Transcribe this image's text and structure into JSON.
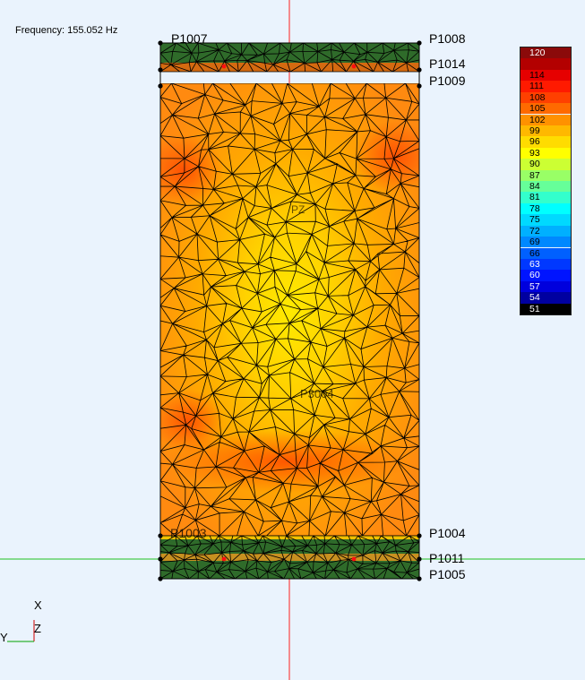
{
  "frequency_label": "Frequency: 155.052 Hz",
  "points": {
    "p1007": "P1007",
    "p1008": "P1008",
    "p1014": "P1014",
    "p1009": "P1009",
    "p1003": "P1003",
    "p1004": "P1004",
    "p1011": "P1011",
    "p1005": "P1005",
    "p3004": "P3004",
    "pz": "PZ"
  },
  "axes": {
    "x": "X",
    "y": "Y",
    "z": "Z"
  },
  "legend": {
    "entries": [
      {
        "label": "120",
        "color": "#8b0a0a"
      },
      {
        "label": "",
        "color": "#b30000"
      },
      {
        "label": "114",
        "color": "#e60000"
      },
      {
        "label": "111",
        "color": "#ff1a00"
      },
      {
        "label": "108",
        "color": "#ff4000"
      },
      {
        "label": "105",
        "color": "#ff6a00"
      },
      {
        "label": "102",
        "color": "#ff9100"
      },
      {
        "label": "99",
        "color": "#ffb800"
      },
      {
        "label": "96",
        "color": "#ffdc00"
      },
      {
        "label": "93",
        "color": "#ffff00"
      },
      {
        "label": "90",
        "color": "#ccff33"
      },
      {
        "label": "87",
        "color": "#99ff66"
      },
      {
        "label": "84",
        "color": "#66ff99"
      },
      {
        "label": "81",
        "color": "#33ffcc"
      },
      {
        "label": "78",
        "color": "#00ffff"
      },
      {
        "label": "75",
        "color": "#00d9ff"
      },
      {
        "label": "72",
        "color": "#00b0ff"
      },
      {
        "label": "69",
        "color": "#0088ff"
      },
      {
        "label": "66",
        "color": "#0060ff"
      },
      {
        "label": "63",
        "color": "#0038ff"
      },
      {
        "label": "60",
        "color": "#0014ff"
      },
      {
        "label": "57",
        "color": "#0000dd"
      },
      {
        "label": "54",
        "color": "#0000a0"
      },
      {
        "label": "51",
        "color": "#000000"
      }
    ]
  }
}
